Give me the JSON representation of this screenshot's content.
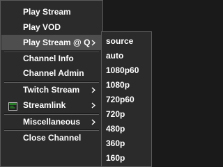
{
  "menu": {
    "items": [
      {
        "label": "Play Stream"
      },
      {
        "label": "Play VOD"
      },
      {
        "label": "Play Stream @ Q"
      },
      {
        "label": "Channel Info"
      },
      {
        "label": "Channel Admin"
      },
      {
        "label": "Twitch Stream"
      },
      {
        "label": "Streamlink",
        "icon": "terminal-icon"
      },
      {
        "label": "Miscellaneous"
      },
      {
        "label": "Close Channel"
      }
    ]
  },
  "submenu": {
    "items": [
      {
        "label": "source"
      },
      {
        "label": "auto"
      },
      {
        "label": "1080p60"
      },
      {
        "label": "1080p"
      },
      {
        "label": "720p60"
      },
      {
        "label": "720p"
      },
      {
        "label": "480p"
      },
      {
        "label": "360p"
      },
      {
        "label": "160p"
      }
    ]
  },
  "colors": {
    "background": "#2b2b2b",
    "border": "#5a5a5a",
    "text": "#ffffff",
    "highlight": "#4e4e4e",
    "icon_green": "#2fb12f"
  }
}
